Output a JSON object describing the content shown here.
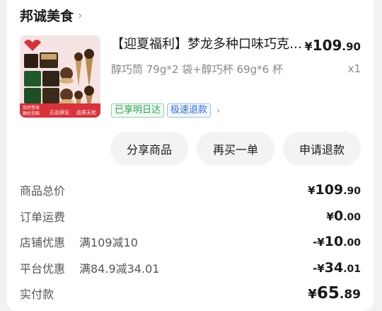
{
  "shop": {
    "name": "邦诚美食",
    "chevron": "›"
  },
  "product": {
    "title": "【迎夏福利】梦龙多种口味巧克力...",
    "price_symbol": "¥",
    "price_int": "109",
    "price_dec": ".90",
    "spec": "醇巧筒 79g*2 袋+醇巧杯 69g*6 杯",
    "quantity": "x1",
    "tags": [
      "已享明日达",
      "极速退款"
    ],
    "thumb_overlay": [
      "及时签收",
      "融化包赔",
      "正品保证",
      "品质无忧"
    ]
  },
  "actions": {
    "share": "分享商品",
    "rebuy": "再买一单",
    "refund": "申请退款"
  },
  "summary": {
    "subtotal": {
      "label": "商品总价",
      "sym": "¥",
      "int": "109",
      "dec": ".90"
    },
    "shipping": {
      "label": "订单运费",
      "sym": "¥",
      "int": "0",
      "dec": ".00"
    },
    "store_discount": {
      "label": "店铺优惠",
      "desc": "满109减10",
      "sym": "-¥",
      "int": "10",
      "dec": ".00"
    },
    "platform_discount": {
      "label": "平台优惠",
      "desc": "满84.9减34.01",
      "sym": "-¥",
      "int": "34",
      "dec": ".01"
    },
    "paid": {
      "label": "实付款",
      "sym": "¥",
      "int": "65",
      "dec": ".89"
    }
  }
}
